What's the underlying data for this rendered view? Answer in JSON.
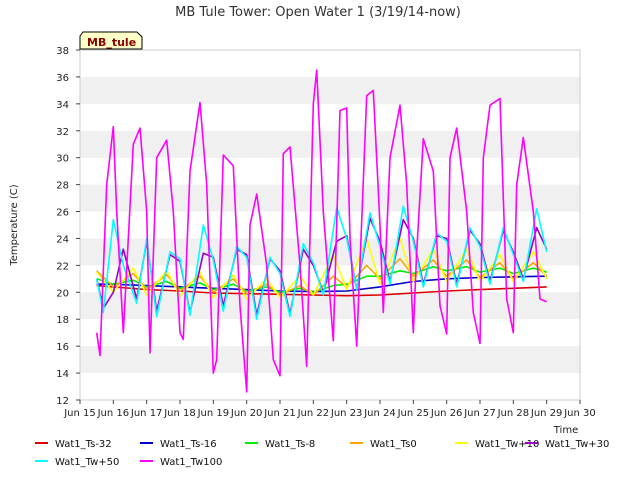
{
  "chart_data": {
    "type": "line",
    "title": "MB Tule Tower: Open Water 1 (3/19/14-now)",
    "site_label": "MB_tule",
    "xlabel": "Time",
    "ylabel": "Temperature (C)",
    "ylim": [
      12,
      38
    ],
    "yticks": [
      12,
      14,
      16,
      18,
      20,
      22,
      24,
      26,
      28,
      30,
      32,
      34,
      36,
      38
    ],
    "xlim": [
      15,
      30
    ],
    "xticks": [
      15,
      16,
      17,
      18,
      19,
      20,
      21,
      22,
      23,
      24,
      25,
      26,
      27,
      28,
      29,
      30
    ],
    "xtick_labels": [
      "Jun 15",
      "Jun 16",
      "Jun 17",
      "Jun 18",
      "Jun 19",
      "Jun 20",
      "Jun 21",
      "Jun 22",
      "Jun 23",
      "Jun 24",
      "Jun 25",
      "Jun 26",
      "Jun 27",
      "Jun 28",
      "Jun 29",
      "Jun 30"
    ],
    "grid": "horizontal bands",
    "legend_position": "bottom",
    "series": [
      {
        "name": "Wat1_Ts-32",
        "color": "#dd0000",
        "x": [
          15.5,
          16,
          17,
          18,
          19,
          20,
          21,
          22,
          23,
          24,
          25,
          26,
          27,
          28,
          29
        ],
        "y": [
          20.5,
          20.4,
          20.2,
          20.1,
          19.95,
          19.9,
          19.85,
          19.8,
          19.75,
          19.8,
          19.95,
          20.1,
          20.2,
          20.3,
          20.4
        ]
      },
      {
        "name": "Wat1_Ts-16",
        "color": "#0000cc",
        "x": [
          15.5,
          16,
          17,
          18,
          19,
          20,
          21,
          22,
          23,
          24,
          25,
          26,
          27,
          28,
          29
        ],
        "y": [
          20.6,
          20.6,
          20.5,
          20.4,
          20.3,
          20.2,
          20.1,
          20.05,
          20.1,
          20.4,
          20.8,
          21.0,
          21.1,
          21.15,
          21.2
        ]
      },
      {
        "name": "Wat1_Ts-8",
        "color": "#00ee00",
        "x": [
          15.5,
          16,
          16.6,
          17,
          17.6,
          18,
          18.6,
          19,
          19.6,
          20,
          20.6,
          21,
          21.6,
          22,
          22.6,
          23,
          23.6,
          24,
          24.6,
          25,
          25.6,
          26,
          26.6,
          27,
          27.6,
          28,
          28.6,
          29
        ],
        "y": [
          21.0,
          20.6,
          20.9,
          20.4,
          20.8,
          20.3,
          20.7,
          20.2,
          20.6,
          20.1,
          20.4,
          20.0,
          20.3,
          20.0,
          20.5,
          20.6,
          21.2,
          21.2,
          21.6,
          21.4,
          21.9,
          21.6,
          21.9,
          21.5,
          21.8,
          21.4,
          21.8,
          21.5
        ]
      },
      {
        "name": "Wat1_Ts0",
        "color": "#ffa500",
        "x": [
          15.5,
          16,
          16.6,
          17,
          17.6,
          18,
          18.6,
          19,
          19.6,
          20,
          20.6,
          21,
          21.6,
          22,
          22.6,
          23,
          23.6,
          24,
          24.6,
          25,
          25.6,
          26,
          26.6,
          27,
          27.6,
          28,
          28.6,
          29
        ],
        "y": [
          21.6,
          20.4,
          21.4,
          20.2,
          21.3,
          20.1,
          21.2,
          20.0,
          21.0,
          19.9,
          20.6,
          19.8,
          20.5,
          19.8,
          21.2,
          20.4,
          22.0,
          21.0,
          22.5,
          21.2,
          22.4,
          21.2,
          22.4,
          21.1,
          22.2,
          21.0,
          22.2,
          21.2
        ]
      },
      {
        "name": "Wat1_Tw+10",
        "color": "#ffff00",
        "x": [
          15.5,
          16,
          16.6,
          17,
          17.6,
          18,
          18.6,
          19,
          19.6,
          20,
          20.6,
          21,
          21.6,
          22,
          22.6,
          23,
          23.6,
          24,
          24.6,
          25,
          25.6,
          26,
          26.6,
          27,
          27.6,
          28,
          28.6,
          29
        ],
        "y": [
          21.5,
          20.0,
          21.8,
          19.8,
          21.6,
          19.7,
          21.5,
          19.6,
          21.3,
          19.5,
          21.0,
          19.6,
          21.2,
          19.8,
          22.8,
          20.2,
          24.0,
          20.6,
          24.0,
          20.8,
          23.2,
          20.8,
          23.2,
          20.8,
          22.8,
          20.8,
          23.0,
          21.0
        ]
      },
      {
        "name": "Wat1_Tw+30",
        "color": "#9900cc",
        "x": [
          15.5,
          15.7,
          16,
          16.3,
          16.7,
          17,
          17.3,
          17.7,
          18,
          18.3,
          18.7,
          19,
          19.3,
          19.7,
          20,
          20.3,
          20.7,
          21,
          21.3,
          21.7,
          22,
          22.3,
          22.7,
          23,
          23.3,
          23.7,
          24,
          24.3,
          24.7,
          25,
          25.3,
          25.7,
          26,
          26.3,
          26.7,
          27,
          27.3,
          27.7,
          28,
          28.3,
          28.7,
          29
        ],
        "y": [
          21.0,
          18.8,
          20.0,
          23.2,
          19.5,
          23.8,
          18.6,
          22.8,
          22.3,
          18.5,
          22.9,
          22.6,
          19.0,
          23.2,
          22.8,
          18.3,
          22.5,
          21.6,
          18.4,
          23.2,
          22.0,
          20.0,
          23.8,
          24.2,
          20.2,
          25.5,
          23.8,
          20.8,
          25.4,
          24.0,
          20.6,
          24.2,
          24.0,
          20.6,
          24.6,
          23.6,
          20.8,
          24.6,
          23.0,
          21.0,
          24.8,
          23.2
        ]
      },
      {
        "name": "Wat1_Tw+50",
        "color": "#00ffff",
        "x": [
          15.5,
          15.7,
          16,
          16.3,
          16.7,
          17,
          17.3,
          17.7,
          18,
          18.3,
          18.7,
          19,
          19.3,
          19.7,
          20,
          20.3,
          20.7,
          21,
          21.3,
          21.7,
          22,
          22.3,
          22.7,
          23,
          23.3,
          23.7,
          24,
          24.3,
          24.7,
          25,
          25.3,
          25.7,
          26,
          26.3,
          26.7,
          27,
          27.3,
          27.7,
          28,
          28.3,
          28.7,
          29
        ],
        "y": [
          21.0,
          18.5,
          25.4,
          22.0,
          19.2,
          24.0,
          18.2,
          23.0,
          22.5,
          18.3,
          25.0,
          22.4,
          18.6,
          23.4,
          22.6,
          18.0,
          22.6,
          21.4,
          18.2,
          23.6,
          22.2,
          19.8,
          26.3,
          24.0,
          20.2,
          25.9,
          23.4,
          20.6,
          26.4,
          23.8,
          20.4,
          24.4,
          23.8,
          20.4,
          24.8,
          23.4,
          20.6,
          24.8,
          22.8,
          20.8,
          26.2,
          23.0
        ]
      },
      {
        "name": "Wat1_Tw100",
        "color": "#ff00ff",
        "x": [
          15.5,
          15.6,
          15.8,
          16.0,
          16.1,
          16.3,
          16.6,
          16.8,
          17.0,
          17.1,
          17.3,
          17.6,
          17.8,
          18.0,
          18.1,
          18.3,
          18.6,
          18.8,
          19.0,
          19.1,
          19.3,
          19.6,
          19.8,
          20.0,
          20.1,
          20.3,
          20.6,
          20.8,
          21.0,
          21.1,
          21.3,
          21.6,
          21.8,
          22.0,
          22.1,
          22.3,
          22.6,
          22.8,
          23.0,
          23.1,
          23.3,
          23.6,
          23.8,
          24.0,
          24.1,
          24.3,
          24.6,
          24.8,
          25.0,
          25.1,
          25.3,
          25.6,
          25.8,
          26.0,
          26.1,
          26.3,
          26.6,
          26.8,
          27.0,
          27.1,
          27.3,
          27.6,
          27.8,
          28.0,
          28.1,
          28.3,
          28.6,
          28.8,
          29.0
        ],
        "y": [
          17.0,
          15.3,
          28.0,
          32.3,
          26.0,
          17.0,
          31.0,
          32.2,
          26.0,
          15.5,
          30.0,
          31.3,
          26.0,
          17.0,
          16.5,
          29.0,
          34.1,
          28.0,
          14.0,
          15.0,
          30.2,
          29.4,
          19.0,
          12.6,
          25.0,
          27.3,
          22.0,
          15.0,
          13.8,
          30.3,
          30.8,
          22.0,
          14.5,
          34.0,
          36.5,
          26.0,
          16.4,
          33.5,
          33.7,
          24.0,
          16.0,
          34.6,
          35.0,
          25.0,
          18.5,
          30.0,
          33.9,
          28.0,
          17.0,
          23.0,
          31.4,
          29.0,
          19.0,
          16.9,
          30.0,
          32.2,
          26.0,
          18.5,
          16.2,
          30.0,
          33.9,
          34.4,
          19.5,
          17.0,
          28.0,
          31.5,
          26.0,
          19.5,
          19.3
        ]
      }
    ]
  }
}
